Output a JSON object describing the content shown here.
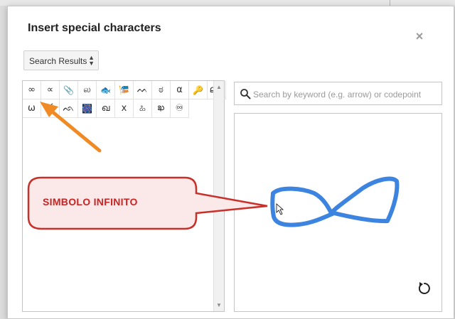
{
  "dialog": {
    "title": "Insert special characters",
    "close_symbol": "×",
    "category_select": {
      "value": "Search Results"
    },
    "search": {
      "placeholder": "Search by keyword (e.g. arrow) or codepoint",
      "icon": "search-icon"
    },
    "reset_icon": "reset-rotate-icon",
    "characters": [
      {
        "glyph": "∞",
        "name": "infinity"
      },
      {
        "glyph": "∝",
        "name": "proportional-to"
      },
      {
        "glyph": "📎",
        "name": "paperclip",
        "emoji": true
      },
      {
        "glyph": "ல",
        "name": "tamil-la"
      },
      {
        "glyph": "🐟",
        "name": "fish",
        "emoji": true
      },
      {
        "glyph": "🎏",
        "name": "carp-streamer",
        "emoji": true
      },
      {
        "glyph": "ᨓ",
        "name": "tai-tham-letter"
      },
      {
        "glyph": "ಠ",
        "name": "kannada-tha"
      },
      {
        "glyph": "α",
        "name": "alpha"
      },
      {
        "glyph": "🔑",
        "name": "key",
        "emoji": true
      },
      {
        "glyph": "ലറ",
        "name": "malayalam-la"
      },
      {
        "glyph": "ω",
        "name": "omega"
      },
      {
        "glyph": "ఠ",
        "name": "telugu-tha"
      },
      {
        "glyph": "ᨒ",
        "name": "tai-tham-letter-2"
      },
      {
        "glyph": "🎆",
        "name": "fireworks",
        "emoji": true
      },
      {
        "glyph": "ഖ",
        "name": "malayalam-kha"
      },
      {
        "glyph": "x",
        "name": "latin-x"
      },
      {
        "glyph": "ಹಿ",
        "name": "kannada-hi"
      },
      {
        "glyph": "ఖ",
        "name": "telugu-kha"
      },
      {
        "glyph": "♾",
        "name": "infinity-circled"
      }
    ]
  },
  "annotation": {
    "callout_text": "SIMBOLO INFINITO",
    "callout_color": "#cc2222",
    "arrow_color": "#f08a24",
    "stroke_color": "#3d84e0"
  },
  "backdrop": {
    "color": "#dcdcdc"
  }
}
